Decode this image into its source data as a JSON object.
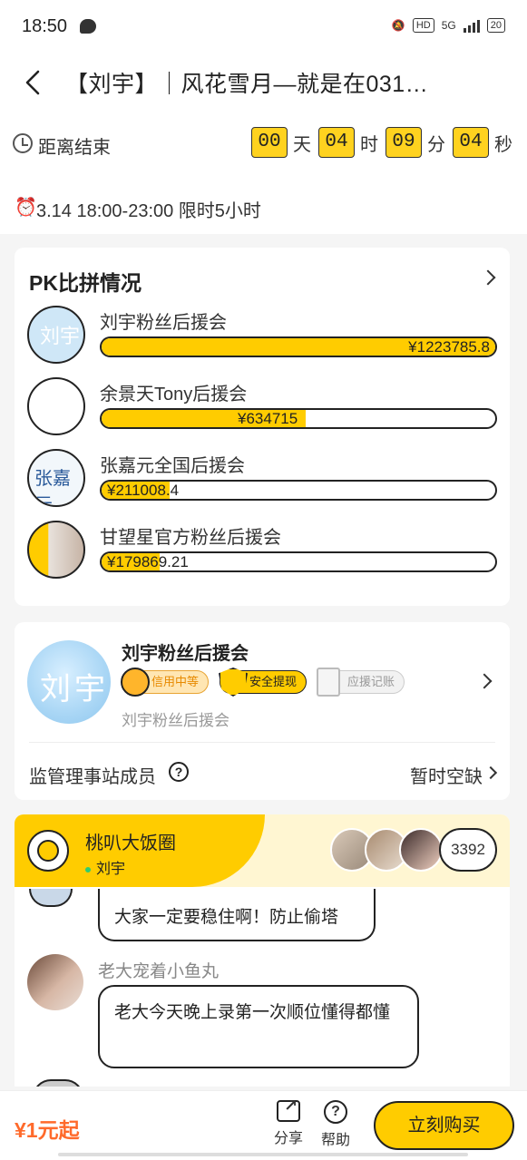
{
  "status_bar": {
    "time": "18:50",
    "network": "5G",
    "hd": "HD",
    "battery": "20"
  },
  "header": {
    "title": "【刘宇】｜风花雪月—就是在031…"
  },
  "countdown": {
    "label": "距离结束",
    "days": "00",
    "days_unit": "天",
    "hours": "04",
    "hours_unit": "时",
    "minutes": "09",
    "minutes_unit": "分",
    "seconds": "04",
    "seconds_unit": "秒"
  },
  "time_info": {
    "text": "3.14 18:00-23:00 限时5小时"
  },
  "pk": {
    "title": "PK比拼情况",
    "entries": [
      {
        "name": "刘宇粉丝后援会",
        "amount": "¥1223785.8",
        "fill": 1.0
      },
      {
        "name": "余景天Tony后援会",
        "amount": "¥634715",
        "fill": 0.518
      },
      {
        "name": "张嘉元全国后援会",
        "amount": "¥211008.4",
        "fill": 0.172
      },
      {
        "name": "甘望星官方粉丝后援会",
        "amount": "¥179869.21",
        "fill": 0.147
      }
    ]
  },
  "club": {
    "name": "刘宇粉丝后援会",
    "badges": {
      "credit": "信用中等",
      "safe": "安全提现",
      "record": "应援记账"
    },
    "subtitle": "刘宇粉丝后援会",
    "supervisor_label": "监管理事站成员",
    "supervisor_status": "暂时空缺"
  },
  "circle": {
    "name": "桃叭大饭圈",
    "member": "刘宇",
    "count": "3392",
    "messages": [
      {
        "sender": "",
        "text": "大家一定要稳住啊！防止偷塔"
      },
      {
        "sender": "老大宠着小鱼丸",
        "text": "老大今天晚上录第一次顺位懂得都懂"
      }
    ]
  },
  "bottom": {
    "price": "¥1元起",
    "share": "分享",
    "help": "帮助",
    "buy": "立刻购买"
  },
  "colors": {
    "accent": "#ffcc00",
    "price": "#ff6a2b"
  }
}
